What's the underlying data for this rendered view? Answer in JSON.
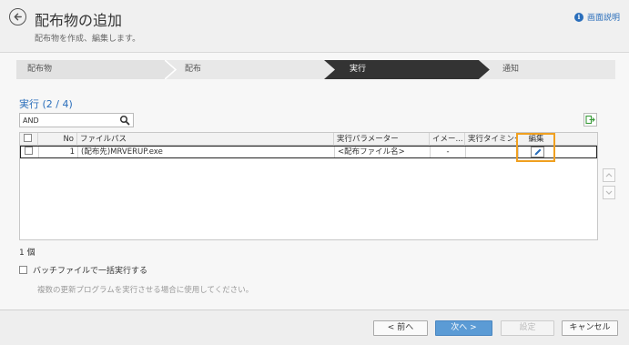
{
  "header": {
    "title": "配布物の追加",
    "subtitle": "配布物を作成、編集します。",
    "help_label": "画面説明",
    "help_icon": "info-icon",
    "back_icon": "back-arrow-icon"
  },
  "steps": [
    {
      "label": "配布物",
      "state": "done"
    },
    {
      "label": "配布",
      "state": "done"
    },
    {
      "label": "実行",
      "state": "active"
    },
    {
      "label": "通知",
      "state": "pending"
    }
  ],
  "section": {
    "title": "実行 (2 / 4)"
  },
  "search": {
    "value": "AND",
    "placeholder": ""
  },
  "table": {
    "columns": [
      "No",
      "ファイルパス",
      "実行パラメーター",
      "イメー...",
      "実行タイミング",
      "編集"
    ],
    "rows": [
      {
        "no": "1",
        "path": "(配布先)MRVERUP.exe",
        "params": "<配布ファイル名>",
        "image": "-",
        "timing": ""
      }
    ]
  },
  "count_label": "1 個",
  "batch": {
    "label": "バッチファイルで一括実行する",
    "checked": false
  },
  "note": "複数の更新プログラムを実行させる場合に使用してください。",
  "footer": {
    "prev": "< 前へ",
    "next": "次へ >",
    "set": "設定",
    "cancel": "キャンセル"
  },
  "colors": {
    "accent": "#2a6ebb",
    "step_active": "#333333",
    "step_done": "#e2e2e2",
    "highlight": "#f0a020",
    "primary_button": "#5b9bd5"
  }
}
